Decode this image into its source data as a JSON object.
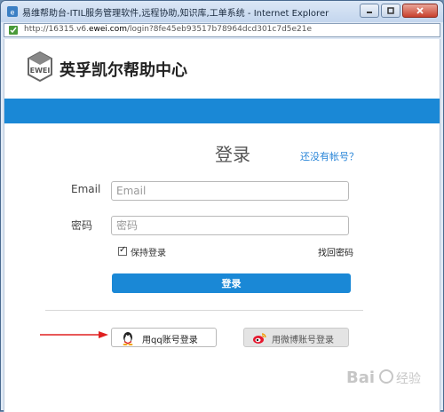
{
  "window": {
    "title": "易维帮助台-ITIL服务管理软件,远程协助,知识库,工单系统 - Internet Explorer",
    "address_prefix": "http://16315.v6.",
    "address_host": "ewei.com",
    "address_suffix": "/login?8fe45eb93517b78964dcd301c7d5e21e"
  },
  "brand": {
    "logo_text": "EWEI",
    "name": "英孚凯尔帮助中心",
    "band_color": "#1a88d6"
  },
  "login": {
    "title": "登录",
    "signup_link": "还没有帐号？",
    "email_label": "Email",
    "email_placeholder": "Email",
    "password_label": "密码",
    "password_placeholder": "密码",
    "remember_label": "保持登录",
    "remember_checked": true,
    "forgot_link": "找回密码",
    "submit_label": "登录"
  },
  "social": {
    "qq_label": "用qq账号登录",
    "weibo_label": "用微博账号登录"
  },
  "colors": {
    "accent": "#1a88d6",
    "link": "#2a86d8",
    "annotation_arrow": "#e02020"
  }
}
